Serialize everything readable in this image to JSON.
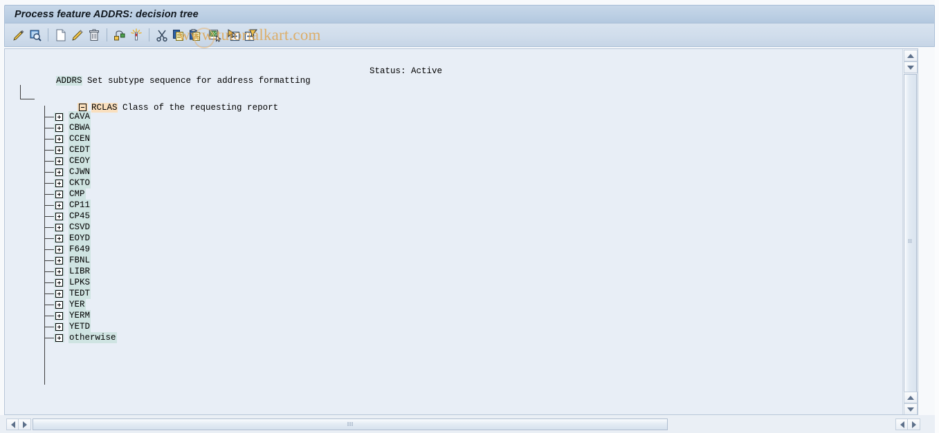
{
  "window": {
    "title": "Process feature ADDRS: decision tree"
  },
  "toolbar": {
    "buttons": [
      {
        "name": "change-mode-icon",
        "label": "Change"
      },
      {
        "name": "display-search-icon",
        "label": "Display/Search"
      },
      {
        "name": "new-page-icon",
        "label": "Create"
      },
      {
        "name": "edit-pencil-icon",
        "label": "Change node"
      },
      {
        "name": "delete-trash-icon",
        "label": "Delete"
      },
      {
        "name": "structure-icon",
        "label": "Create structure"
      },
      {
        "name": "magic-wand-icon",
        "label": "Insert node"
      },
      {
        "name": "cut-scissors-icon",
        "label": "Cut"
      },
      {
        "name": "copy-icon",
        "label": "Copy"
      },
      {
        "name": "paste-icon",
        "label": "Paste"
      },
      {
        "name": "paste-doc-icon",
        "label": "Insert"
      },
      {
        "name": "expand-subtree-icon",
        "label": "Expand subtree"
      },
      {
        "name": "collapse-subtree-icon",
        "label": "Collapse subtree"
      }
    ],
    "watermark": "www.tutorialkart.com"
  },
  "tree": {
    "header": {
      "feature_id": "ADDRS",
      "feature_text": " Set subtype sequence for address formatting",
      "status": "Status: Active"
    },
    "root": {
      "id": "RCLAS",
      "text": " Class of the requesting report",
      "expanded": true,
      "icon": "folder-open-icon"
    },
    "children": [
      {
        "label": "CAVA"
      },
      {
        "label": "CBWA"
      },
      {
        "label": "CCEN"
      },
      {
        "label": "CEDT"
      },
      {
        "label": "CEOY"
      },
      {
        "label": "CJWN"
      },
      {
        "label": "CKTO"
      },
      {
        "label": "CMP"
      },
      {
        "label": "CP11"
      },
      {
        "label": "CP45"
      },
      {
        "label": "CSVD"
      },
      {
        "label": "EOYD"
      },
      {
        "label": "F649"
      },
      {
        "label": "FBNL"
      },
      {
        "label": "LIBR"
      },
      {
        "label": "LPKS"
      },
      {
        "label": "TEDT"
      },
      {
        "label": "YER"
      },
      {
        "label": "YERM"
      },
      {
        "label": "YETD"
      },
      {
        "label": "otherwise"
      }
    ]
  },
  "colors": {
    "node_highlight": "#cfe4e2",
    "root_highlight": "#f9dfbe",
    "panel_background": "#e8eef6",
    "titlebar": "#bed1e5",
    "watermark": "#e0a145"
  }
}
